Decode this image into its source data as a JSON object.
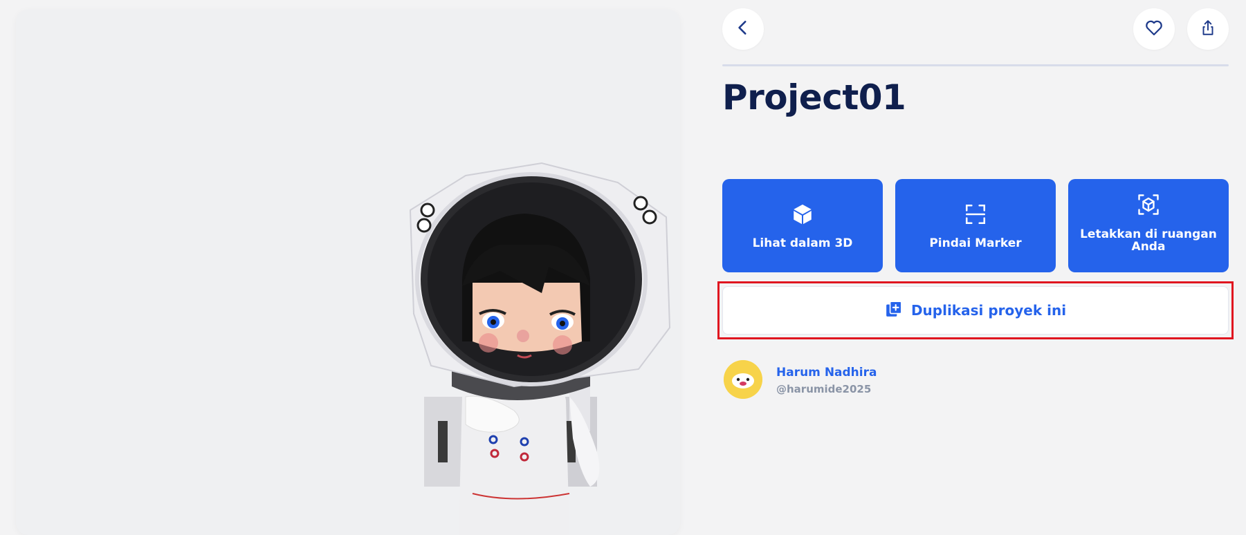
{
  "viewer": {
    "model": "astronaut-girl-3d-model"
  },
  "header": {
    "back_icon": "chevron-left-icon",
    "favorite_icon": "heart-icon",
    "share_icon": "share-icon"
  },
  "project": {
    "title": "Project01"
  },
  "actions": [
    {
      "label": "Lihat dalam 3D",
      "icon": "cube-icon"
    },
    {
      "label": "Pindai Marker",
      "icon": "scan-frame-icon"
    },
    {
      "label": "Letakkan di ruangan Anda",
      "icon": "ar-cube-icon"
    }
  ],
  "duplicate": {
    "label": "Duplikasi proyek ini",
    "icon": "copy-plus-icon"
  },
  "author": {
    "name": "Harum Nadhira",
    "handle": "@harumide2025"
  },
  "colors": {
    "accent": "#2563eb",
    "title": "#0f1f4d",
    "highlight": "#e0151f",
    "avatar": "#f7d34a"
  }
}
